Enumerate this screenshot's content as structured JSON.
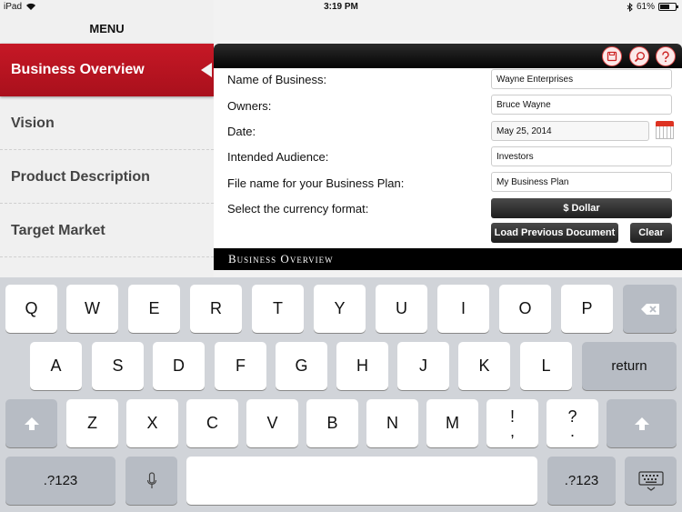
{
  "status_bar": {
    "device": "iPad",
    "time": "3:19 PM",
    "battery": "61%",
    "battery_level": 0.61
  },
  "sidebar": {
    "title": "MENU",
    "items": [
      {
        "label": "Business Overview"
      },
      {
        "label": "Vision"
      },
      {
        "label": "Product Description"
      },
      {
        "label": "Target Market"
      }
    ]
  },
  "form": {
    "fields": [
      {
        "label": "Name of Business:",
        "value": "Wayne Enterprises"
      },
      {
        "label": "Owners:",
        "value": "Bruce Wayne"
      },
      {
        "label": "Date:",
        "value": "May 25, 2014"
      },
      {
        "label": "Intended Audience:",
        "value": "Investors"
      },
      {
        "label": "File name for your Business Plan:",
        "value": "My Business Plan"
      }
    ],
    "currency_label": "Select the currency format:",
    "currency_value": "$ Dollar",
    "load_button": "Load Previous Document",
    "clear_button": "Clear"
  },
  "section_title": "Business Overview",
  "keyboard": {
    "row1": [
      "Q",
      "W",
      "E",
      "R",
      "T",
      "Y",
      "U",
      "I",
      "O",
      "P"
    ],
    "row2": [
      "A",
      "S",
      "D",
      "F",
      "G",
      "H",
      "J",
      "K",
      "L"
    ],
    "row3": [
      "Z",
      "X",
      "C",
      "V",
      "B",
      "N",
      "M"
    ],
    "return": "return",
    "numbers": ".?123",
    "exclam": [
      "!",
      ","
    ],
    "question": [
      "?",
      "."
    ]
  },
  "icons": {
    "save": "save-icon",
    "search": "search-icon",
    "help": "help-icon"
  },
  "colors": {
    "accent": "#c61826",
    "toolbar": "#111111"
  }
}
